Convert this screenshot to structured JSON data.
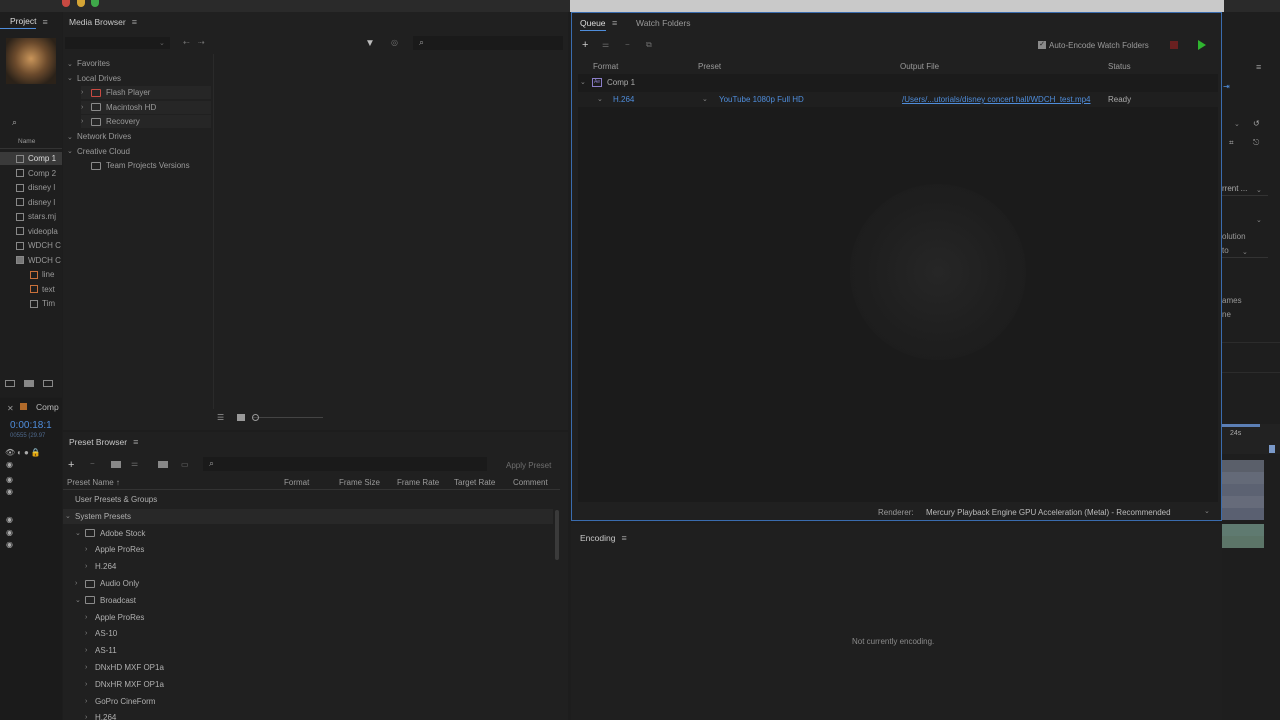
{
  "colors": {
    "accent": "#4f8ddb",
    "panel": "#1f1f1f",
    "dark": "#151515",
    "green": "#2fb52f",
    "red": "#8a2323"
  },
  "project": {
    "tab": "Project",
    "name_col": "Name",
    "items": [
      "Comp 1",
      "Comp 2",
      "disney l",
      "disney l",
      "stars.mj",
      "videopla",
      "WDCH C",
      "WDCH C",
      "line",
      "text",
      "Tim"
    ]
  },
  "timeline": {
    "tab": "Comp",
    "timecode": "0:00:18:1",
    "sub": "00555 (29.97"
  },
  "media_browser": {
    "title": "Media Browser",
    "tree": [
      {
        "label": "Favorites",
        "level": 0
      },
      {
        "label": "Local Drives",
        "level": 0
      },
      {
        "label": "Flash Player",
        "level": 1
      },
      {
        "label": "Macintosh HD",
        "level": 1
      },
      {
        "label": "Recovery",
        "level": 1
      },
      {
        "label": "Network Drives",
        "level": 0
      },
      {
        "label": "Creative Cloud",
        "level": 0
      },
      {
        "label": "Team Projects Versions",
        "level": 1
      }
    ]
  },
  "preset_browser": {
    "title": "Preset Browser",
    "apply_label": "Apply Preset",
    "columns": [
      "Preset Name",
      "Format",
      "Frame Size",
      "Frame Rate",
      "Target Rate",
      "Comment"
    ],
    "items": [
      {
        "label": "User Presets & Groups",
        "level": 0
      },
      {
        "label": "System Presets",
        "level": 0
      },
      {
        "label": "Adobe Stock",
        "level": 1
      },
      {
        "label": "Apple ProRes",
        "level": 2
      },
      {
        "label": "H.264",
        "level": 2
      },
      {
        "label": "Audio Only",
        "level": 1
      },
      {
        "label": "Broadcast",
        "level": 1
      },
      {
        "label": "Apple ProRes",
        "level": 2
      },
      {
        "label": "AS-10",
        "level": 2
      },
      {
        "label": "AS-11",
        "level": 2
      },
      {
        "label": "DNxHD MXF OP1a",
        "level": 2
      },
      {
        "label": "DNxHR MXF OP1a",
        "level": 2
      },
      {
        "label": "GoPro CineForm",
        "level": 2
      },
      {
        "label": "H.264",
        "level": 2
      }
    ]
  },
  "queue": {
    "tabs": [
      "Queue",
      "Watch Folders"
    ],
    "auto_encode": "Auto-Encode Watch Folders",
    "columns": [
      "Format",
      "Preset",
      "Output File",
      "Status"
    ],
    "item": "Comp 1",
    "row": {
      "format": "H.264",
      "preset": "YouTube 1080p Full HD",
      "output": "/Users/...utorials/disney concert hall/WDCH_test.mp4",
      "status": "Ready"
    },
    "renderer_label": "Renderer:",
    "renderer_value": "Mercury Playback Engine GPU Acceleration (Metal) - Recommended"
  },
  "encoding": {
    "title": "Encoding",
    "message": "Not currently encoding."
  },
  "right_strip": {
    "current": "rrent ...",
    "olution": "olution",
    "to": "to",
    "ames": "ames",
    "ne": "ne",
    "ruler": "24s"
  }
}
